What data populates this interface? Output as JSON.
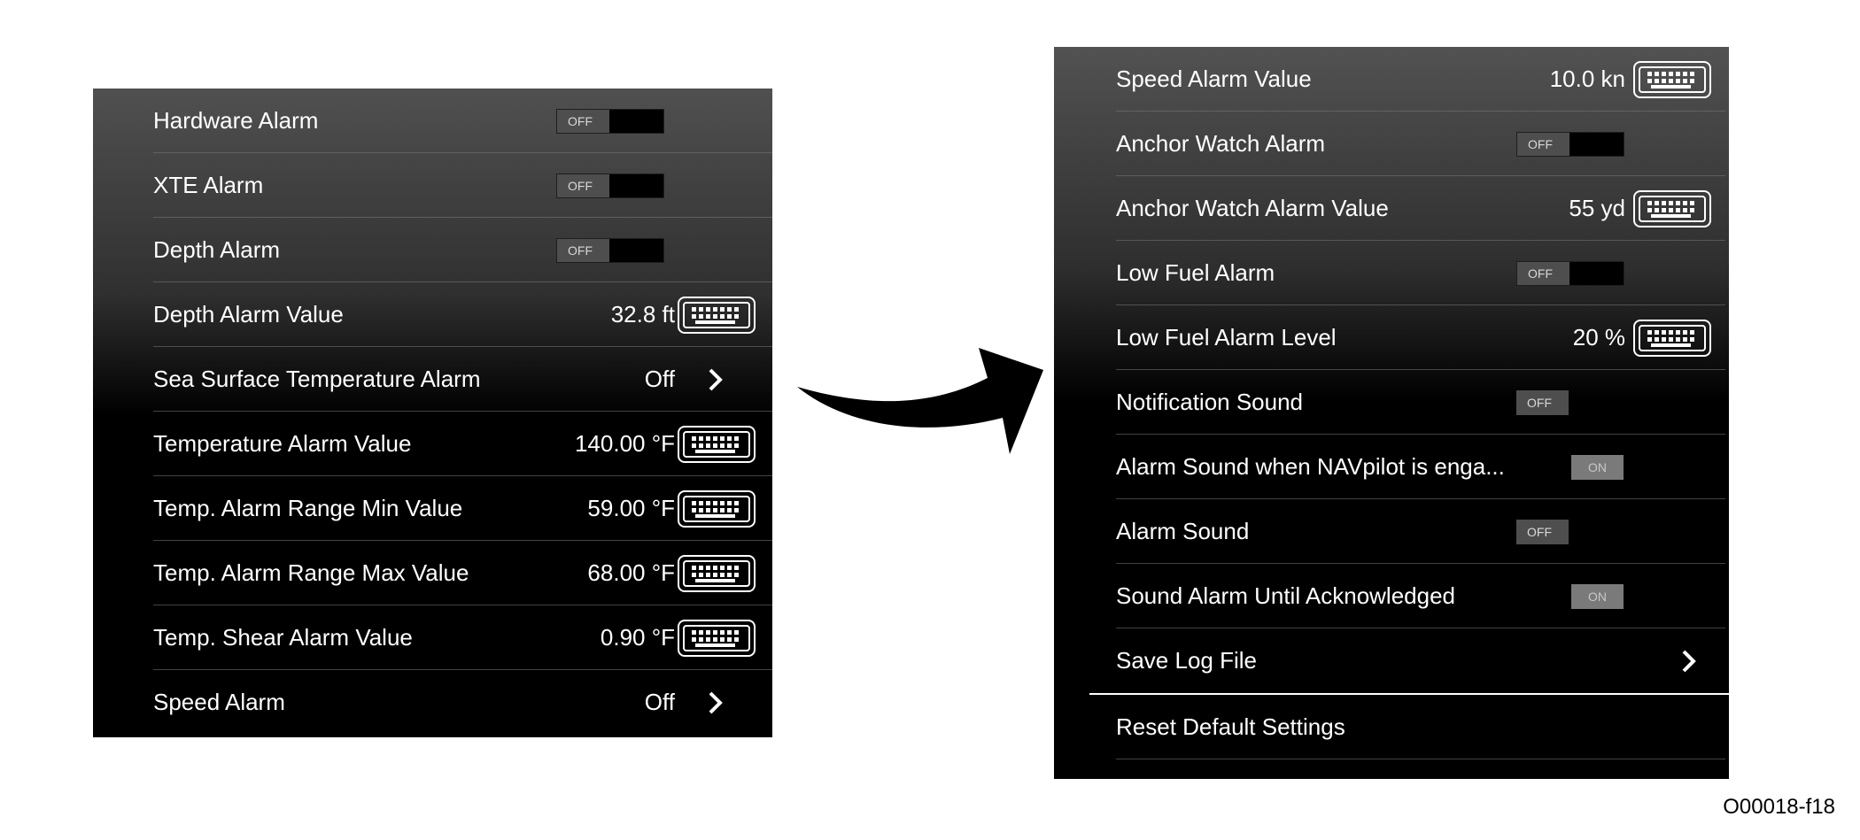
{
  "left_panel": {
    "rows": [
      {
        "label": "Hardware Alarm",
        "toggle": "OFF"
      },
      {
        "label": "XTE Alarm",
        "toggle": "OFF"
      },
      {
        "label": "Depth Alarm",
        "toggle": "OFF"
      },
      {
        "label": "Depth Alarm Value",
        "value": "32.8 ft"
      },
      {
        "label": "Sea Surface Temperature Alarm",
        "value": "Off"
      },
      {
        "label": "Temperature Alarm Value",
        "value": "140.00 °F"
      },
      {
        "label": "Temp. Alarm Range Min Value",
        "value": "59.00 °F"
      },
      {
        "label": "Temp. Alarm Range Max Value",
        "value": "68.00 °F"
      },
      {
        "label": "Temp. Shear Alarm Value",
        "value": "0.90 °F"
      },
      {
        "label": "Speed Alarm",
        "value": "Off"
      }
    ]
  },
  "right_panel": {
    "rows": [
      {
        "label": "Speed Alarm Value",
        "value": "10.0 kn"
      },
      {
        "label": "Anchor Watch Alarm",
        "toggle": "OFF"
      },
      {
        "label": "Anchor Watch Alarm Value",
        "value": "55 yd"
      },
      {
        "label": "Low Fuel Alarm",
        "toggle": "OFF"
      },
      {
        "label": "Low Fuel Alarm Level",
        "value": "20 %"
      },
      {
        "label": "Notification Sound",
        "toggle": "OFF"
      },
      {
        "label": "Alarm Sound when NAVpilot is enga...",
        "toggle": "ON"
      },
      {
        "label": "Alarm Sound",
        "toggle": "OFF"
      },
      {
        "label": "Sound Alarm Until Acknowledged",
        "toggle": "ON"
      },
      {
        "label": "Save Log File"
      },
      {
        "label": "Reset Default Settings"
      }
    ]
  },
  "icons": {
    "keyboard": "keyboard-icon",
    "chevron": "chevron-right-icon",
    "arrow": "curved-arrow-icon"
  },
  "figure_code": "O00018-f18"
}
